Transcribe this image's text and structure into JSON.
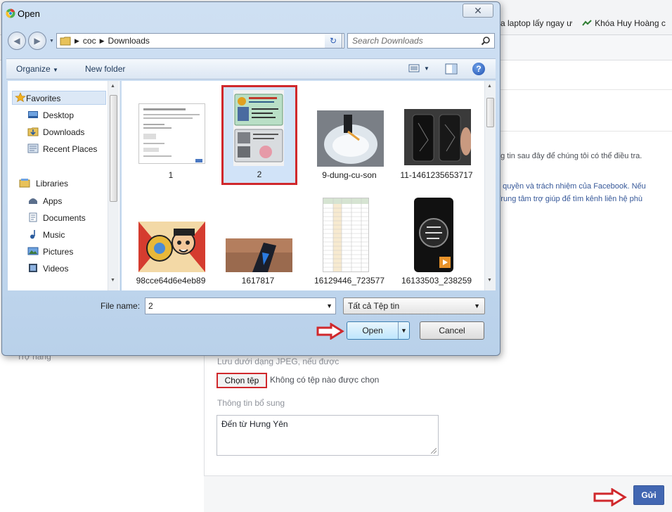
{
  "browser": {
    "bookmarks": [
      {
        "label": "a laptop lấy ngay ư",
        "icon": "bookmark-icon"
      },
      {
        "label": "Khóa Huy Hoàng c",
        "icon": "bookmark-icon"
      }
    ]
  },
  "page": {
    "info_line_1": "ng tin sau đây để chúng tôi có thể điều tra.",
    "info_line_2": "ề quyền và trách nhiệm của Facebook. Nếu",
    "info_line_3": "Trung tâm trợ giúp để tìm kênh liên hệ phù",
    "left_label": "Trợ năng",
    "save_hint": "Lưu dưới dạng JPEG, nếu được",
    "choose_file_label": "Chọn tệp",
    "no_file_text": "Không có tệp nào được chọn",
    "extra_info_label": "Thông tin bổ sung",
    "extra_info_value": "Đến từ Hưng Yên",
    "send_label": "Gửi"
  },
  "dialog": {
    "title": "Open",
    "breadcrumb": [
      "coc",
      "Downloads"
    ],
    "search_placeholder": "Search Downloads",
    "toolbar": {
      "organize_label": "Organize",
      "new_folder_label": "New folder"
    },
    "nav": {
      "favorites_label": "Favorites",
      "favorites": [
        "Desktop",
        "Downloads",
        "Recent Places"
      ],
      "libraries_label": "Libraries",
      "libraries": [
        "Apps",
        "Documents",
        "Music",
        "Pictures",
        "Videos"
      ]
    },
    "files": [
      {
        "label": "1",
        "selected": false
      },
      {
        "label": "2",
        "selected": true
      },
      {
        "label": "9-dung-cu-son",
        "selected": false
      },
      {
        "label": "11-1461235653717",
        "selected": false
      },
      {
        "label": "98cce64d6e4eb89",
        "selected": false
      },
      {
        "label": "1617817",
        "selected": false
      },
      {
        "label": "16129446_723577",
        "selected": false
      },
      {
        "label": "16133503_238259",
        "selected": false
      }
    ],
    "filename_label": "File name:",
    "filename_value": "2",
    "filetype_value": "Tất cả Tệp tin",
    "open_label": "Open",
    "cancel_label": "Cancel"
  },
  "colors": {
    "highlight_red": "#d0282c",
    "facebook_blue": "#4267b2"
  }
}
